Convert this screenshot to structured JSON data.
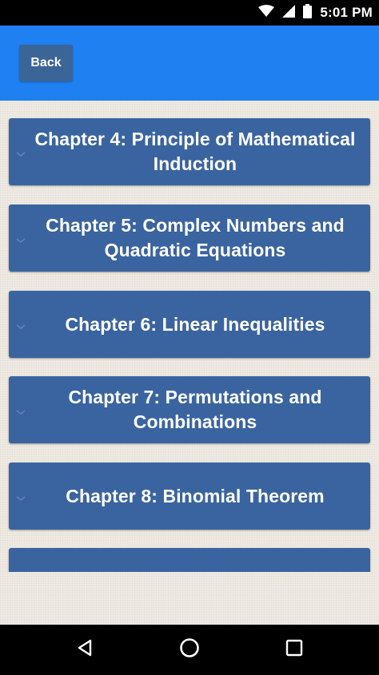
{
  "status_bar": {
    "time": "5:01 PM",
    "icons": [
      "wifi-icon",
      "signal-icon",
      "battery-icon"
    ]
  },
  "app_bar": {
    "back_label": "Back",
    "color": "#1f80f2"
  },
  "chapters": [
    {
      "title": "Chapter 4: Principle of Mathematical Induction"
    },
    {
      "title": "Chapter 5: Complex Numbers and Quadratic Equations"
    },
    {
      "title": "Chapter 6: Linear Inequalities"
    },
    {
      "title": "Chapter 7: Permutations and Combinations"
    },
    {
      "title": "Chapter 8: Binomial Theorem"
    }
  ],
  "nav_bar": {
    "buttons": [
      "back-triangle-icon",
      "home-circle-icon",
      "recents-square-icon"
    ]
  },
  "colors": {
    "card": "#3a64a0",
    "background": "#efebe4",
    "back_button": "#3b6497"
  }
}
